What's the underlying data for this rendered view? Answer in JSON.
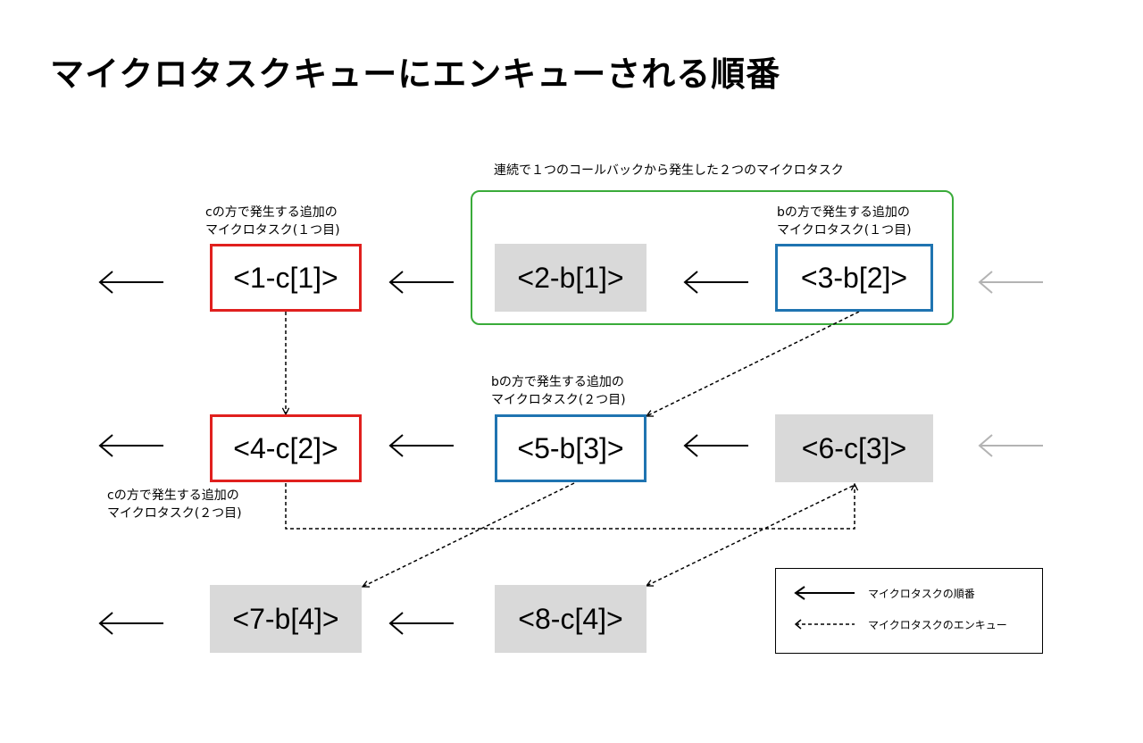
{
  "title": "マイクロタスクキューにエンキューされる順番",
  "group_label": "連続で１つのコールバックから発生した２つのマイクロタスク",
  "nodes": {
    "n1": "<1-c[1]>",
    "n2": "<2-b[1]>",
    "n3": "<3-b[2]>",
    "n4": "<4-c[2]>",
    "n5": "<5-b[3]>",
    "n6": "<6-c[3]>",
    "n7": "<7-b[4]>",
    "n8": "<8-c[4]>"
  },
  "captions": {
    "c1_line1": "cの方で発生する追加の",
    "c1_line2": "マイクロタスク(１つ目)",
    "b1_line1": "bの方で発生する追加の",
    "b1_line2": "マイクロタスク(１つ目)",
    "b2_line1": "bの方で発生する追加の",
    "b2_line2": "マイクロタスク(２つ目)",
    "c2_line1": "cの方で発生する追加の",
    "c2_line2": "マイクロタスク(２つ目)"
  },
  "legend": {
    "order_label": "マイクロタスクの順番",
    "enqueue_label": "マイクロタスクのエンキュー"
  },
  "colors": {
    "red": "#e0201e",
    "blue": "#1f74b1",
    "green": "#3aab3a",
    "gray_box": "#d9d9d9",
    "gray_arrow": "#b3b3b3"
  }
}
